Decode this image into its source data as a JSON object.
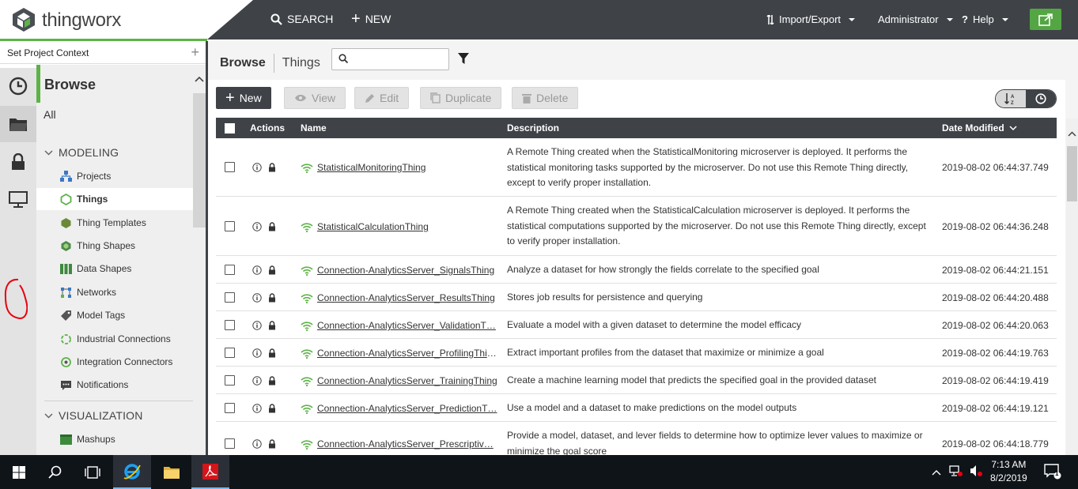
{
  "app": {
    "brand": "thingworx"
  },
  "topbar": {
    "search": "SEARCH",
    "new": "NEW",
    "import_export": "Import/Export",
    "user": "Administrator",
    "help": "Help"
  },
  "project_context": {
    "label": "Set Project Context"
  },
  "browse_panel": {
    "title": "Browse",
    "all": "All",
    "sections": {
      "modeling": "MODELING",
      "visualization": "VISUALIZATION"
    },
    "items": [
      {
        "label": "Projects",
        "icon": "projects-icon"
      },
      {
        "label": "Things",
        "icon": "things-icon",
        "active": true
      },
      {
        "label": "Thing Templates",
        "icon": "thing-templates-icon"
      },
      {
        "label": "Thing Shapes",
        "icon": "thing-shapes-icon"
      },
      {
        "label": "Data Shapes",
        "icon": "data-shapes-icon"
      },
      {
        "label": "Networks",
        "icon": "networks-icon"
      },
      {
        "label": "Model Tags",
        "icon": "model-tags-icon"
      },
      {
        "label": "Industrial Connections",
        "icon": "industrial-connections-icon"
      },
      {
        "label": "Integration Connectors",
        "icon": "integration-connectors-icon"
      },
      {
        "label": "Notifications",
        "icon": "notifications-icon"
      }
    ],
    "viz_items": [
      {
        "label": "Mashups",
        "icon": "mashups-icon"
      }
    ]
  },
  "main": {
    "breadcrumb": {
      "root": "Browse",
      "current": "Things"
    },
    "search_placeholder": "",
    "toolbar": {
      "new": "New",
      "view": "View",
      "edit": "Edit",
      "duplicate": "Duplicate",
      "delete": "Delete"
    },
    "columns": {
      "actions": "Actions",
      "name": "Name",
      "description": "Description",
      "date_modified": "Date Modified"
    },
    "rows": [
      {
        "name": "StatisticalMonitoringThing",
        "description": "A Remote Thing created when the StatisticalMonitoring microserver is deployed. It performs the statistical monitoring tasks supported by the microserver. Do not use this Remote Thing directly, except to verify proper installation.",
        "date": "2019-08-02 06:44:37.749"
      },
      {
        "name": "StatisticalCalculationThing",
        "description": "A Remote Thing created when the StatisticalCalculation microserver is deployed. It performs the statistical computations supported by the microserver. Do not use this Remote Thing directly, except to verify proper installation.",
        "date": "2019-08-02 06:44:36.248"
      },
      {
        "name": "Connection-AnalyticsServer_SignalsThing",
        "description": "Analyze a dataset for how strongly the fields correlate to the specified goal",
        "date": "2019-08-02 06:44:21.151"
      },
      {
        "name": "Connection-AnalyticsServer_ResultsThing",
        "description": "Stores job results for persistence and querying",
        "date": "2019-08-02 06:44:20.488"
      },
      {
        "name": "Connection-AnalyticsServer_ValidationT…",
        "description": "Evaluate a model with a given dataset to determine the model efficacy",
        "date": "2019-08-02 06:44:20.063"
      },
      {
        "name": "Connection-AnalyticsServer_ProfilingThing",
        "description": "Extract important profiles from the dataset that maximize or minimize a goal",
        "date": "2019-08-02 06:44:19.763"
      },
      {
        "name": "Connection-AnalyticsServer_TrainingThing",
        "description": "Create a machine learning model that predicts the specified goal in the provided dataset",
        "date": "2019-08-02 06:44:19.419"
      },
      {
        "name": "Connection-AnalyticsServer_PredictionT…",
        "description": "Use a model and a dataset to make predictions on the model outputs",
        "date": "2019-08-02 06:44:19.121"
      },
      {
        "name": "Connection-AnalyticsServer_Prescriptiv…",
        "description": "Provide a model, dataset, and lever fields to determine how to optimize lever values to maximize or minimize the goal score",
        "date": "2019-08-02 06:44:18.779"
      }
    ]
  },
  "taskbar": {
    "time": "7:13 AM",
    "date": "8/2/2019",
    "notifications": "1"
  },
  "colors": {
    "accent": "#5cb346",
    "topbar": "#3f4348",
    "annotation": "#e8000f"
  }
}
